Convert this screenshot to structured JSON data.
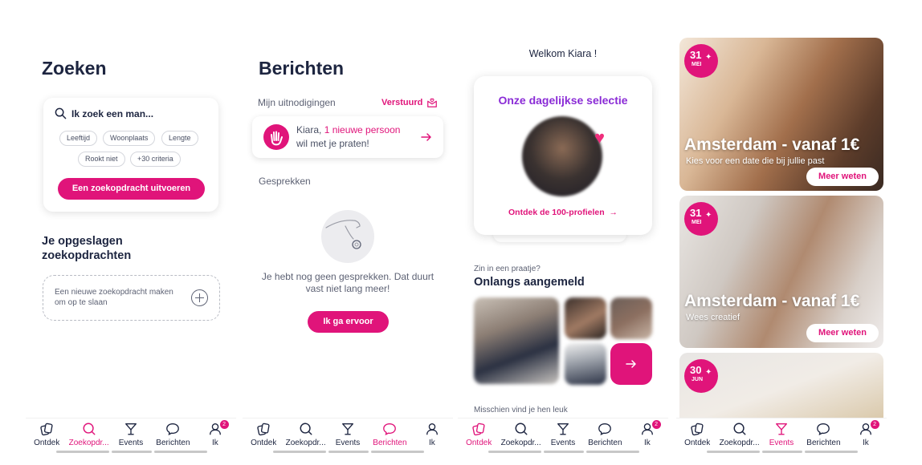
{
  "colors": {
    "accent": "#e0147a",
    "purple": "#8a2bd6",
    "text": "#1d2540",
    "muted": "#5d6274"
  },
  "search_screen": {
    "title": "Zoeken",
    "search_placeholder": "Ik zoek een man...",
    "chips": [
      "Leeftijd",
      "Woonplaats",
      "Lengte",
      "Rookt niet",
      "+30 criteria"
    ],
    "run_button": "Een zoekopdracht uitvoeren",
    "saved_title": "Je opgeslagen zoekopdrachten",
    "new_search": "Een nieuwe zoekopdracht maken om op te slaan"
  },
  "messages_screen": {
    "title": "Berichten",
    "invitations_label": "Mijn uitnodigingen",
    "sent_label": "Verstuurd",
    "invite_name": "Kiara, ",
    "invite_highlight": "1 nieuwe persoon",
    "invite_rest": "wil met je praten!",
    "conversations_label": "Gesprekken",
    "empty_text": "Je hebt nog geen gesprekken. Dat duurt vast niet lang meer!",
    "cta_button": "Ik ga ervoor"
  },
  "discover_screen": {
    "welcome": "Welkom Kiara !",
    "selection_title": "Onze dagelijkse selectie",
    "selection_link": "Ontdek de 100-profielen",
    "chat_prompt": "Zin in een praatje?",
    "recent_title": "Onlangs aangemeld",
    "maybe_label": "Misschien vind je hen leuk"
  },
  "events_screen": {
    "events": [
      {
        "day": "31",
        "month": "MEI",
        "title": "Amsterdam - vanaf 1€",
        "subtitle": "Kies voor een date die bij jullie past",
        "button": "Meer weten"
      },
      {
        "day": "31",
        "month": "MEI",
        "title": "Amsterdam - vanaf 1€",
        "subtitle": "Wees creatief",
        "button": "Meer weten"
      },
      {
        "day": "30",
        "month": "JUN"
      }
    ]
  },
  "nav": {
    "items": [
      "Ontdek",
      "Zoekopdr...",
      "Events",
      "Berichten",
      "Ik"
    ],
    "badge": "2"
  }
}
